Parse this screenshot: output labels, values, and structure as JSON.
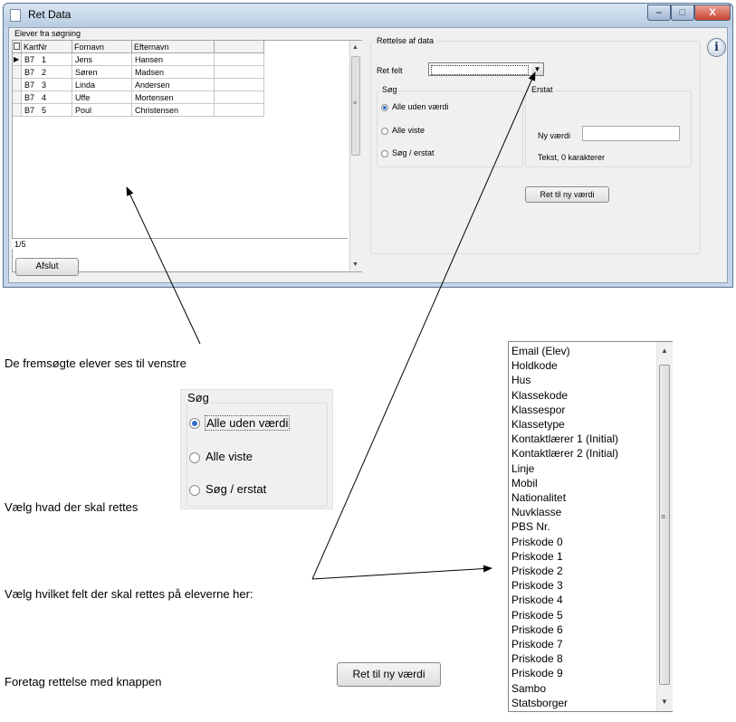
{
  "window": {
    "title": "Ret Data",
    "min_glyph": "‒",
    "max_glyph": "□",
    "close_glyph": "X"
  },
  "grid": {
    "caption": "Elever fra søgning",
    "columns": [
      "",
      "KartNr",
      "Fornavn",
      "Efternavn"
    ],
    "rows": [
      {
        "klasse": "B7",
        "kartnr": "1",
        "fornavn": "Jens",
        "efternavn": "Hansen"
      },
      {
        "klasse": "B7",
        "kartnr": "2",
        "fornavn": "Søren",
        "efternavn": "Madsen"
      },
      {
        "klasse": "B7",
        "kartnr": "3",
        "fornavn": "Linda",
        "efternavn": "Andersen"
      },
      {
        "klasse": "B7",
        "kartnr": "4",
        "fornavn": "Uffe",
        "efternavn": "Mortensen"
      },
      {
        "klasse": "B7",
        "kartnr": "5",
        "fornavn": "Poul",
        "efternavn": "Christensen"
      }
    ],
    "status": "1/5",
    "close_button": "Afslut"
  },
  "edit": {
    "group_title": "Rettelse af data",
    "field_label": "Ret felt",
    "field_value": "",
    "search": {
      "title": "Søg",
      "options": [
        "Alle uden værdi",
        "Alle viste",
        "Søg / erstat"
      ],
      "selected": 0
    },
    "replace": {
      "title": "Erstat",
      "new_value_label": "Ny værdi",
      "new_value": "",
      "hint": "Tekst, 0 karakterer"
    },
    "apply_button": "Ret til ny værdi"
  },
  "annotations": {
    "left_text": "De fremsøgte elever ses til venstre",
    "choose_text": "Vælg hvad der skal rettes",
    "field_text": "Vælg hvilket felt der skal rettes på eleverne her:",
    "apply_text": "Foretag rettelse med knappen",
    "apply_button": "Ret til ny værdi",
    "zoom": {
      "title": "Søg",
      "options": [
        "Alle uden værdi",
        "Alle viste",
        "Søg / erstat"
      ]
    }
  },
  "dropdown": {
    "items": [
      "Email (Elev)",
      "Holdkode",
      "Hus",
      "Klassekode",
      "Klassespor",
      "Klassetype",
      "Kontaktlærer 1 (Initial)",
      "Kontaktlærer 2 (Initial)",
      "Linje",
      "Mobil",
      "Nationalitet",
      "Nuvklasse",
      "PBS Nr.",
      "Priskode 0",
      "Priskode 1",
      "Priskode 2",
      "Priskode 3",
      "Priskode 4",
      "Priskode 5",
      "Priskode 6",
      "Priskode 7",
      "Priskode 8",
      "Priskode 9",
      "Sambo",
      "Statsborger"
    ]
  }
}
